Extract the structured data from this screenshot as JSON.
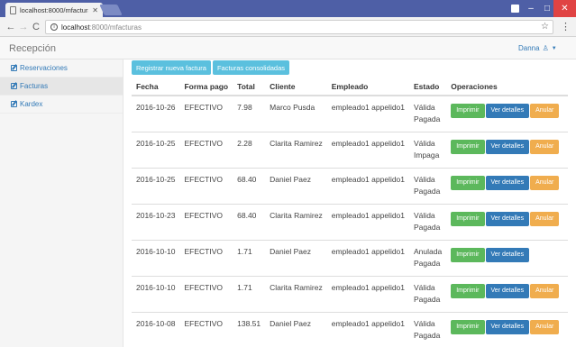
{
  "browser": {
    "tab_title": "localhost:8000/mfacturas",
    "url_host": "localhost",
    "url_rest": ":8000/mfacturas"
  },
  "app": {
    "brand": "Recepción",
    "user": "Danna"
  },
  "sidebar": {
    "items": [
      {
        "label": "Reservaciones"
      },
      {
        "label": "Facturas"
      },
      {
        "label": "Kardex"
      }
    ]
  },
  "actions": {
    "register": "Registrar nueva factura",
    "consolidated": "Facturas consolidadas"
  },
  "table": {
    "headers": {
      "fecha": "Fecha",
      "forma_pago": "Forma pago",
      "total": "Total",
      "cliente": "Cliente",
      "empleado": "Empleado",
      "estado": "Estado",
      "operaciones": "Operaciones"
    },
    "buttons": {
      "print": "Imprimir",
      "details": "Ver detalles",
      "void": "Anular"
    },
    "rows": [
      {
        "fecha": "2016-10-26",
        "forma": "EFECTIVO",
        "total": "7.98",
        "cliente": "Marco Pusda",
        "empleado": "empleado1 appelido1",
        "estado": "Válida",
        "pago": "Pagada"
      },
      {
        "fecha": "2016-10-25",
        "forma": "EFECTIVO",
        "total": "2.28",
        "cliente": "Clarita Ramirez",
        "empleado": "empleado1 appelido1",
        "estado": "Válida",
        "pago": "Impaga"
      },
      {
        "fecha": "2016-10-25",
        "forma": "EFECTIVO",
        "total": "68.40",
        "cliente": "Daniel Paez",
        "empleado": "empleado1 appelido1",
        "estado": "Válida",
        "pago": "Pagada"
      },
      {
        "fecha": "2016-10-23",
        "forma": "EFECTIVO",
        "total": "68.40",
        "cliente": "Clarita Ramirez",
        "empleado": "empleado1 appelido1",
        "estado": "Válida",
        "pago": "Pagada"
      },
      {
        "fecha": "2016-10-10",
        "forma": "EFECTIVO",
        "total": "1.71",
        "cliente": "Daniel Paez",
        "empleado": "empleado1 appelido1",
        "estado": "Anulada",
        "pago": "Pagada"
      },
      {
        "fecha": "2016-10-10",
        "forma": "EFECTIVO",
        "total": "1.71",
        "cliente": "Clarita Ramirez",
        "empleado": "empleado1 appelido1",
        "estado": "Válida",
        "pago": "Pagada"
      },
      {
        "fecha": "2016-10-08",
        "forma": "EFECTIVO",
        "total": "138.51",
        "cliente": "Daniel Paez",
        "empleado": "empleado1 appelido1",
        "estado": "Válida",
        "pago": "Pagada"
      }
    ]
  },
  "colors": {
    "print": "#5cb85c",
    "details": "#337ab7",
    "void": "#f0ad4e",
    "info": "#5bc0de",
    "link": "#337ab7"
  }
}
